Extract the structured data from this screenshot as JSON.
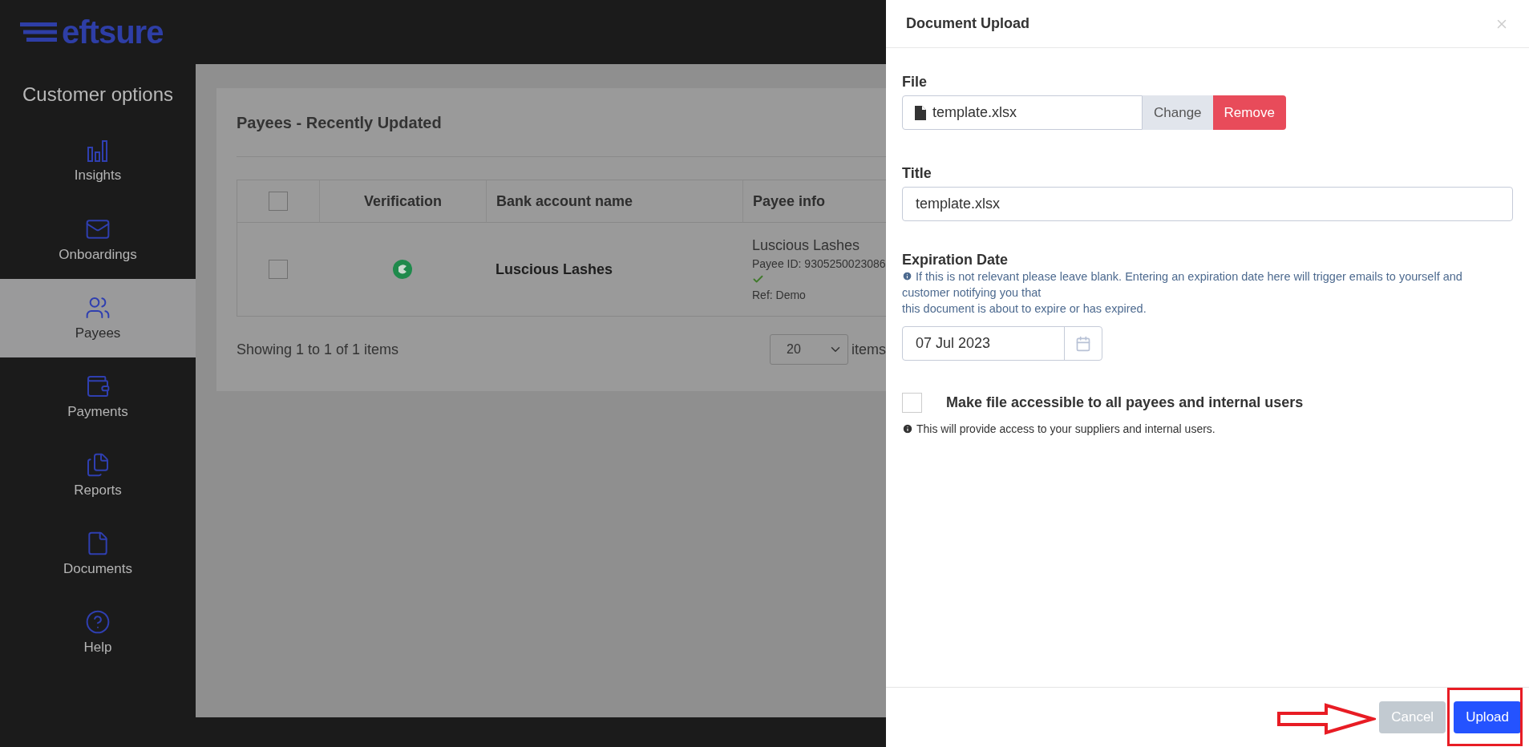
{
  "logo": "eftsure",
  "sidebar": {
    "title": "Customer options",
    "items": [
      {
        "label": "Insights",
        "selected": false
      },
      {
        "label": "Onboardings",
        "selected": false
      },
      {
        "label": "Payees",
        "selected": true
      },
      {
        "label": "Payments",
        "selected": false
      },
      {
        "label": "Reports",
        "selected": false
      },
      {
        "label": "Documents",
        "selected": false
      },
      {
        "label": "Help",
        "selected": false
      }
    ]
  },
  "card": {
    "title": "Payees - Recently Updated",
    "table": {
      "select_all_checked": false,
      "columns": [
        "Verification",
        "Bank account name",
        "Payee info"
      ],
      "rows": [
        {
          "checked": false,
          "bank_account_name": "Luscious Lashes",
          "payee_name": "Luscious Lashes",
          "payee_id": "Payee ID: 9305250023086",
          "ref": "Ref: Demo"
        }
      ]
    },
    "showing": "Showing 1 to 1 of 1 items",
    "page_size": "20",
    "page_size_label": "items"
  },
  "modal": {
    "title": "Document Upload",
    "file": {
      "label": "File",
      "value": "template.xlsx",
      "change": "Change",
      "remove": "Remove"
    },
    "title_field": {
      "label": "Title",
      "value": "template.xlsx"
    },
    "expiration": {
      "label": "Expiration Date",
      "help": [
        "If this is not relevant please leave blank. Entering an expiration date here will trigger emails to yourself and customer notifying you that",
        "this document is about to expire or has expired."
      ],
      "value": "07 Jul 2023"
    },
    "share": {
      "label": "Make file accessible to all payees and internal users",
      "checked": false,
      "note": "This will provide access to your suppliers and internal users."
    },
    "buttons": [
      {
        "label": "Cancel",
        "kind": "secondary"
      },
      {
        "label": "Upload",
        "kind": "primary"
      }
    ]
  }
}
